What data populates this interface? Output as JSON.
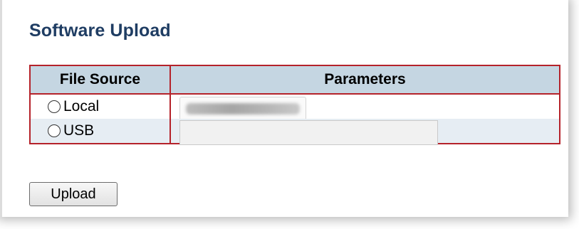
{
  "page": {
    "title": "Software Upload"
  },
  "table": {
    "headers": {
      "file_source": "File Source",
      "parameters": "Parameters"
    },
    "rows": [
      {
        "source_label": "Local"
      },
      {
        "source_label": "USB"
      }
    ]
  },
  "actions": {
    "upload_label": "Upload"
  },
  "colors": {
    "title": "#1f3d63",
    "table_border": "#b5222a",
    "header_bg": "#c5d6e2",
    "alt_row_bg": "#e6edf3"
  }
}
